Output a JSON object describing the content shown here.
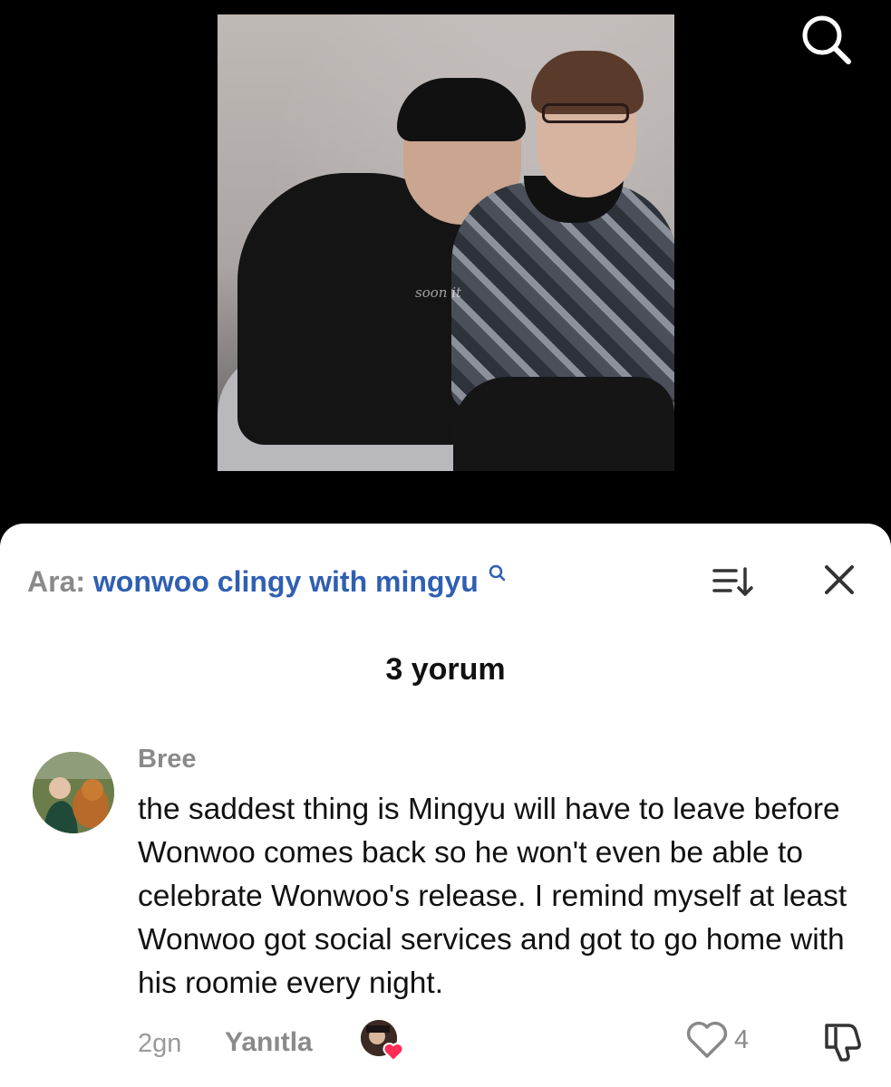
{
  "video": {
    "watermark": "soon it"
  },
  "comments_panel": {
    "search_prefix": "Ara:",
    "search_query": "wonwoo clingy with mingyu",
    "comment_count": "3 yorum",
    "comment": {
      "username": "Bree",
      "text": "the saddest thing is Mingyu will have to leave before Wonwoo comes back so he won't even be able to celebrate Wonwoo's release. I remind myself at least Wonwoo got social services and got to go home with his roomie every night.",
      "time": "2gn",
      "reply_label": "Yanıtla",
      "like_count": "4"
    }
  },
  "icons": {
    "top_search": "search-icon",
    "mini_search": "search-icon",
    "sort": "sort-icon",
    "close": "close-icon",
    "like": "heart-outline-icon",
    "liker_heart": "heart-filled-icon",
    "dislike": "thumbs-down-icon"
  },
  "colors": {
    "background_top": "#000000",
    "sheet": "#ffffff",
    "query_blue": "#2f5fb3",
    "muted_gray": "#8a8a8a",
    "heart_pink": "#ff2d55"
  }
}
